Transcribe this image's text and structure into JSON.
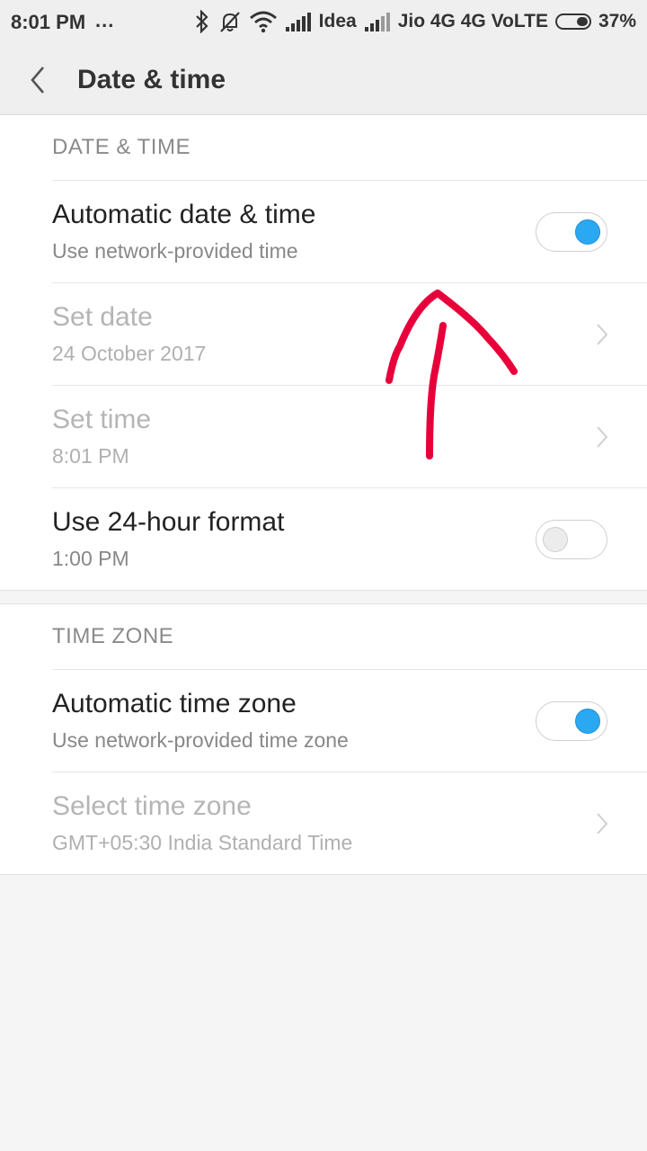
{
  "status_bar": {
    "time": "8:01 PM",
    "dots": "...",
    "carrier1": "Idea",
    "carrier2": "Jio 4G 4G VoLTE",
    "battery": "37%",
    "battery_level": 0.37,
    "icons": [
      "bluetooth-icon",
      "bell-off-icon",
      "wifi-icon",
      "signal-icon",
      "signal-icon"
    ]
  },
  "header": {
    "title": "Date & time",
    "back_icon": "chevron-left-icon"
  },
  "sections": {
    "date_time": {
      "label": "DATE & TIME",
      "auto": {
        "title": "Automatic date & time",
        "subtitle": "Use network-provided time",
        "enabled": true
      },
      "set_date": {
        "title": "Set date",
        "subtitle": "24 October 2017"
      },
      "set_time": {
        "title": "Set time",
        "subtitle": "8:01 PM"
      },
      "format24": {
        "title": "Use 24-hour format",
        "subtitle": "1:00 PM",
        "enabled": false
      }
    },
    "time_zone": {
      "label": "TIME ZONE",
      "auto": {
        "title": "Automatic time zone",
        "subtitle": "Use network-provided time zone",
        "enabled": true
      },
      "select": {
        "title": "Select time zone",
        "subtitle": "GMT+05:30 India Standard Time"
      }
    }
  },
  "colors": {
    "toggle_on": "#2aa8f2",
    "annotation": "#e8003a"
  }
}
